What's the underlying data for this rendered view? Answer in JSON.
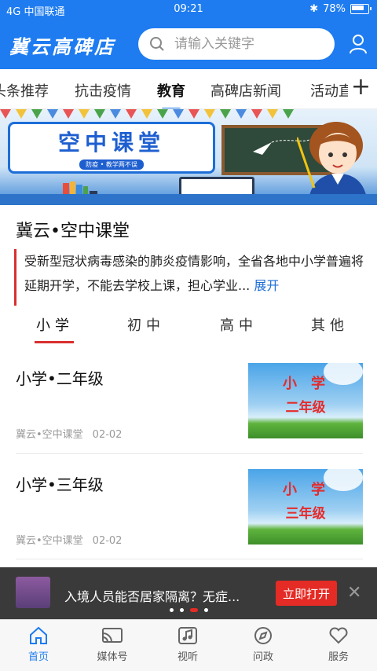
{
  "status": {
    "carrier": "中国联通",
    "signal": "4G",
    "time": "09:21",
    "battery": "78%"
  },
  "header": {
    "brand": "冀云高碑店",
    "search_placeholder": "请输入关键字"
  },
  "tabs": [
    {
      "label": "头条推荐"
    },
    {
      "label": "抗击疫情"
    },
    {
      "label": "教育",
      "active": true
    },
    {
      "label": "高碑店新闻"
    },
    {
      "label": "活动直"
    }
  ],
  "banner": {
    "title": "空中课堂",
    "subtitle": "防疫 • 教学两不误"
  },
  "article": {
    "title": "冀云•空中课堂",
    "summary": "受新型冠状病毒感染的肺炎疫情影响，全省各地中小学普遍将延期开学，不能去学校上课，担心学业...",
    "expand": "展开"
  },
  "subtabs": [
    {
      "label": "小学",
      "active": true
    },
    {
      "label": "初中"
    },
    {
      "label": "高中"
    },
    {
      "label": "其他"
    }
  ],
  "news": [
    {
      "title": "小学•二年级",
      "source": "冀云•空中课堂",
      "date": "02-02",
      "thumb_line1": "小学",
      "thumb_line2": "二年级"
    },
    {
      "title": "小学•三年级",
      "source": "冀云•空中课堂",
      "date": "02-02",
      "thumb_line1": "小学",
      "thumb_line2": "三年级"
    }
  ],
  "promo": {
    "text": "入境人员能否居家隔离？无症...",
    "button": "立即打开"
  },
  "bottom_nav": [
    {
      "label": "首页",
      "icon": "home-icon",
      "active": true
    },
    {
      "label": "媒体号",
      "icon": "cast-icon"
    },
    {
      "label": "视听",
      "icon": "music-icon"
    },
    {
      "label": "问政",
      "icon": "compass-icon"
    },
    {
      "label": "服务",
      "icon": "heart-icon"
    }
  ],
  "colors": {
    "primary": "#1e7cf0",
    "accent_red": "#d9302f"
  }
}
